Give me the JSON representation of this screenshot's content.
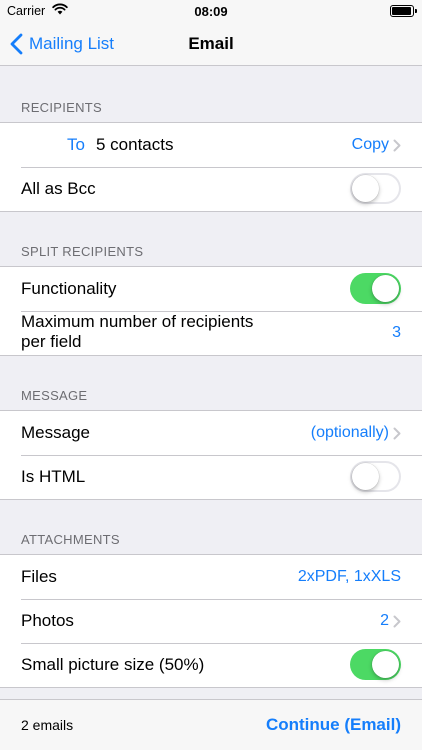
{
  "status_bar": {
    "carrier": "Carrier",
    "time": "08:09"
  },
  "nav": {
    "back_label": "Mailing List",
    "title": "Email"
  },
  "recipients": {
    "header": "RECIPIENTS",
    "to_key": "To",
    "to_value": "5 contacts",
    "copy_label": "Copy",
    "bcc_label": "All as Bcc",
    "bcc_on": false
  },
  "split": {
    "header": "SPLIT RECIPIENTS",
    "functionality_label": "Functionality",
    "functionality_on": true,
    "max_label": "Maximum number of recipients per field",
    "max_value": "3"
  },
  "message": {
    "header": "MESSAGE",
    "message_label": "Message",
    "message_value": "(optionally)",
    "html_label": "Is HTML",
    "html_on": false
  },
  "attachments": {
    "header": "ATTACHMENTS",
    "files_label": "Files",
    "files_value": "2xPDF, 1xXLS",
    "photos_label": "Photos",
    "photos_value": "2",
    "small_label": "Small picture size (50%)",
    "small_on": true
  },
  "toolbar": {
    "count": "2 emails",
    "continue_label": "Continue (Email)"
  },
  "colors": {
    "accent": "#157efb",
    "switch_on": "#4cd964",
    "background": "#efeff4"
  }
}
